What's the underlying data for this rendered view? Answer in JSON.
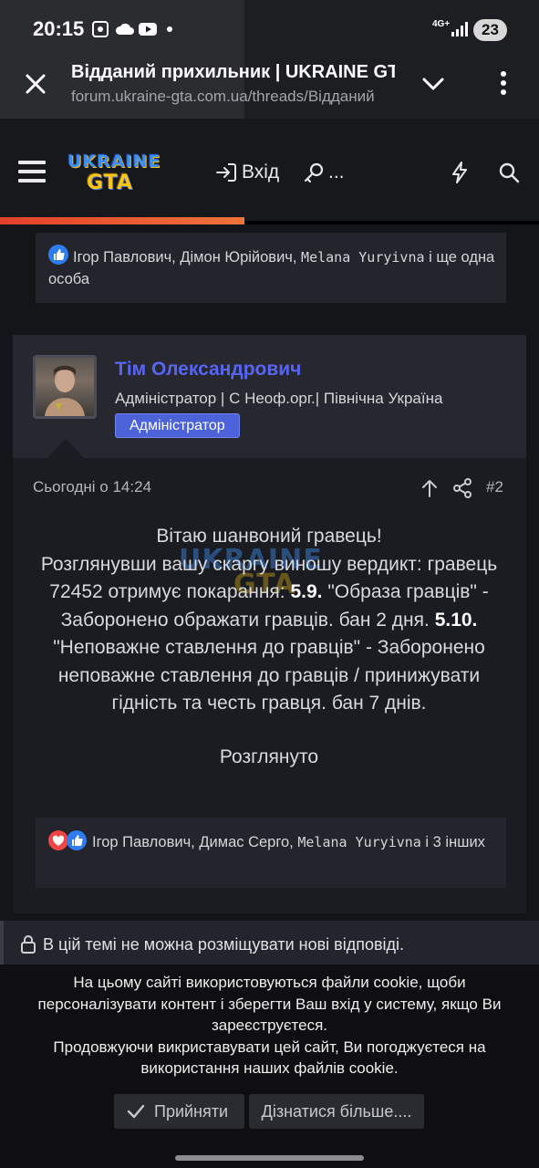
{
  "status_bar": {
    "time": "20:15",
    "network": "4G+",
    "battery": "23",
    "icons": [
      "screenshot-icon",
      "cloud-icon",
      "youtube-icon",
      "dot-icon",
      "signal-icon"
    ]
  },
  "browser": {
    "title": "Відданий прихильник | UKRAINE GTA",
    "url": "forum.ukraine-gta.com.ua/threads/Відданий",
    "icons": [
      "close-icon",
      "chevron-down-icon",
      "more-vert-icon"
    ]
  },
  "forum_header": {
    "logo_top": "UKRAINE",
    "logo_bottom": "GTA",
    "login_label": "Вхід",
    "register_label": "...",
    "progress_percent": 45
  },
  "top_reactions": {
    "text_1": "Ігор Павлович, Дімон Юрійович, ",
    "mono_name": "Melana Yuryivna",
    "text_2": " і ще одна особа"
  },
  "post": {
    "author_name": "Тім Олександрович",
    "author_title": "Адміністратор | С Неоф.орг.| Північна Україна",
    "role_badge": "Адміністратор",
    "date": "Сьогодні о 14:24",
    "number": "#2",
    "body": {
      "line1": "Вітаю шанвоний гравець!",
      "line2": "Розглянувши вашу скаргу виношу вердикт: гравець 72452 отримує покарання: ",
      "rule1_num": "5.9.",
      "rule1_text": " \"Образа гравців\" - Заборонено ображати гравців. бан 2 дня. ",
      "rule2_num": "5.10.",
      "rule2_text": " \"Неповажне ставлення до гравців\" - Заборонено неповажне ставлення до гравців / принижувати гідність та честь гравця. бан 7 днів.",
      "status": "Розглянуто"
    },
    "watermark_top": "UKRAINE",
    "watermark_bottom": "GTA"
  },
  "bottom_reactions": {
    "text_1": "Ігор Павлович, Димас Серго, ",
    "mono_name": "Melana Yuryivna",
    "text_2": " і 3 інших"
  },
  "locked_notice": "В цій темі не можна розміщувати нові відповіді.",
  "cookie": {
    "line1": "На цьому сайті використовуються файли cookie, щоби персоналізувати контент і зберегти Ваш вхід у систему, якщо Ви зареєструєтеся.",
    "line2": "Продовжуючи викриставувати цей сайт, Ви погоджуєтеся на використання наших файлів cookie.",
    "accept_label": "Прийняти",
    "learn_more_label": "Дізнатися більше...."
  },
  "colors": {
    "accent": "#4f5be0",
    "badge": "#4b62d9",
    "progress": "#e8502e",
    "background": "#141519"
  }
}
